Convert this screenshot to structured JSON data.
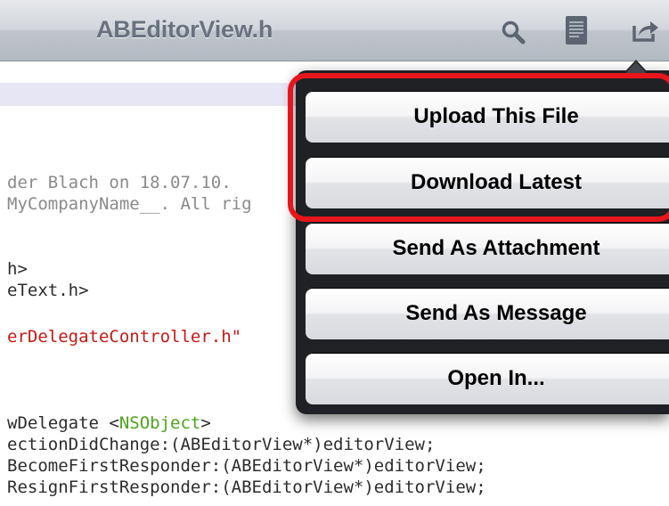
{
  "navbar": {
    "title": "ABEditorView.h",
    "icons": [
      "search-icon",
      "document-icon",
      "share-icon"
    ]
  },
  "editor": {
    "lines": [
      "der Blach on 18.07.10.",
      "MyCompanyName__. All rig",
      "h>",
      "eText.h>",
      "erDelegateController.h\"",
      "wDelegate <",
      "NSObject",
      ">",
      "ectionDidChange:(ABEditorView*)editorView;",
      "BecomeFirstResponder:(ABEditorView*)editorView;",
      "ResignFirstResponder:(ABEditorView*)editorView;"
    ]
  },
  "menu": {
    "items": [
      "Upload This File",
      "Download Latest",
      "Send As Attachment",
      "Send As Message",
      "Open In..."
    ]
  },
  "colors": {
    "highlight": "#e8161b",
    "keyword": "#4ea51c",
    "string": "#c41a16",
    "comment": "#8a8a8a",
    "current_line": "#e6e6f5"
  }
}
